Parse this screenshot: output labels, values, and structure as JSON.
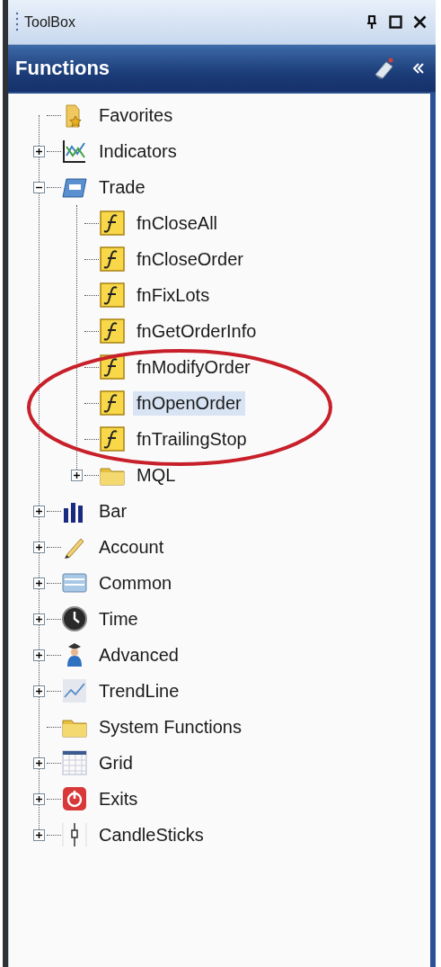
{
  "window": {
    "title": "ToolBox"
  },
  "panel": {
    "title": "Functions"
  },
  "tree": [
    {
      "label": "Favorites",
      "kind": "star-folder",
      "selected": false
    },
    {
      "label": "Indicators",
      "kind": "chart",
      "expanded": false,
      "selected": false
    },
    {
      "label": "Trade",
      "kind": "panel",
      "expanded": true,
      "selected": false,
      "children": [
        {
          "label": "fnCloseAll",
          "kind": "function",
          "selected": false
        },
        {
          "label": "fnCloseOrder",
          "kind": "function",
          "selected": false
        },
        {
          "label": "fnFixLots",
          "kind": "function",
          "selected": false
        },
        {
          "label": "fnGetOrderInfo",
          "kind": "function",
          "selected": false
        },
        {
          "label": "fnModifyOrder",
          "kind": "function",
          "selected": false
        },
        {
          "label": "fnOpenOrder",
          "kind": "function",
          "selected": true
        },
        {
          "label": "fnTrailingStop",
          "kind": "function",
          "selected": false
        },
        {
          "label": "MQL",
          "kind": "folder",
          "expanded": false,
          "selected": false
        }
      ]
    },
    {
      "label": "Bar",
      "kind": "bars",
      "expanded": false,
      "selected": false
    },
    {
      "label": "Account",
      "kind": "pencil",
      "expanded": false,
      "selected": false
    },
    {
      "label": "Common",
      "kind": "cards",
      "expanded": false,
      "selected": false
    },
    {
      "label": "Time",
      "kind": "clock",
      "expanded": false,
      "selected": false
    },
    {
      "label": "Advanced",
      "kind": "figure",
      "expanded": false,
      "selected": false
    },
    {
      "label": "TrendLine",
      "kind": "trend",
      "expanded": false,
      "selected": false
    },
    {
      "label": "System Functions",
      "kind": "folder",
      "selected": false
    },
    {
      "label": "Grid",
      "kind": "grid",
      "expanded": false,
      "selected": false
    },
    {
      "label": "Exits",
      "kind": "power",
      "expanded": false,
      "selected": false
    },
    {
      "label": "CandleSticks",
      "kind": "candle",
      "expanded": false,
      "selected": false
    }
  ]
}
